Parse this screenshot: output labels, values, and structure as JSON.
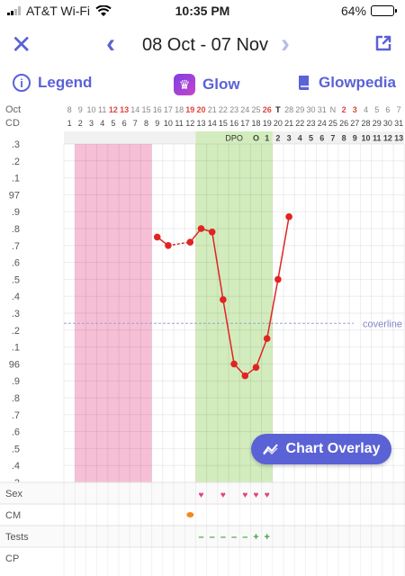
{
  "status_bar": {
    "carrier": "AT&T Wi-Fi",
    "time": "10:35 PM",
    "battery": "64%",
    "battery_level": 0.64
  },
  "nav": {
    "date_range": "08 Oct - 07 Nov"
  },
  "tabs": {
    "legend": "Legend",
    "glow": "Glow",
    "glowpedia": "Glowpedia"
  },
  "header_rows": {
    "month_label": "Oct",
    "cd_label": "CD",
    "dates": [
      "8",
      "9",
      "10",
      "11",
      "12",
      "13",
      "14",
      "15",
      "16",
      "17",
      "18",
      "19",
      "20",
      "21",
      "22",
      "23",
      "24",
      "25",
      "26",
      "T",
      "28",
      "29",
      "30",
      "31",
      "N",
      "2",
      "3",
      "4",
      "5",
      "6",
      "7"
    ],
    "date_colors": [
      "",
      "",
      "",
      "",
      "red",
      "red",
      "",
      "",
      "",
      "",
      "",
      "red",
      "red",
      "",
      "",
      "",
      "",
      "",
      "red",
      "dark",
      "",
      "",
      "",
      "",
      "",
      "red",
      "red",
      "",
      "",
      "",
      ""
    ],
    "cycle_days": [
      "1",
      "2",
      "3",
      "4",
      "5",
      "6",
      "7",
      "8",
      "9",
      "10",
      "11",
      "12",
      "13",
      "14",
      "15",
      "16",
      "17",
      "18",
      "19",
      "20",
      "21",
      "22",
      "23",
      "24",
      "25",
      "26",
      "27",
      "28",
      "29",
      "30",
      "31"
    ],
    "dpo_label": "DPO",
    "dpo_values": [
      "O",
      "1",
      "2",
      "3",
      "4",
      "5",
      "6",
      "7",
      "8",
      "9",
      "10",
      "11",
      "12",
      "13"
    ]
  },
  "y_axis_labels": [
    ".3",
    ".2",
    ".1",
    "97",
    ".9",
    ".8",
    ".7",
    ".6",
    ".5",
    ".4",
    ".3",
    ".2",
    ".1",
    "96",
    ".9",
    ".8",
    ".7",
    ".6",
    ".5",
    ".4",
    ".3"
  ],
  "coverline_label": "coverline",
  "chart_data": {
    "type": "line",
    "x_dates": [
      "Oct 16",
      "Oct 17",
      "Oct 19",
      "Oct 20",
      "Oct 21",
      "Oct 22",
      "Oct 23",
      "Oct 24",
      "Oct 25",
      "Oct 26",
      "Oct 27",
      "Oct 28"
    ],
    "values": [
      97.75,
      97.7,
      97.72,
      97.8,
      97.78,
      97.38,
      97.0,
      96.93,
      96.98,
      97.15,
      97.5,
      97.87
    ],
    "coverline": 97.24,
    "ylim": [
      96.3,
      98.3
    ],
    "highlight_pink_days": [
      1,
      7
    ],
    "highlight_green_days": [
      12,
      18
    ],
    "colors": {
      "line": "#e02424",
      "pink": "#f6bfd6",
      "green": "#d2ecbd",
      "coverline": "#9aa2d8"
    }
  },
  "logs": {
    "rows": [
      "Sex",
      "CM",
      "Tests",
      "CP"
    ],
    "sex_days": [
      12,
      14,
      16,
      17,
      18
    ],
    "cm_days": [
      11
    ],
    "tests": [
      {
        "day": 12,
        "mark": "–"
      },
      {
        "day": 13,
        "mark": "–"
      },
      {
        "day": 14,
        "mark": "–"
      },
      {
        "day": 15,
        "mark": "–"
      },
      {
        "day": 16,
        "mark": "–"
      },
      {
        "day": 17,
        "mark": "+"
      },
      {
        "day": 18,
        "mark": "+"
      }
    ]
  },
  "overlay_button": {
    "label": "Chart Overlay"
  }
}
